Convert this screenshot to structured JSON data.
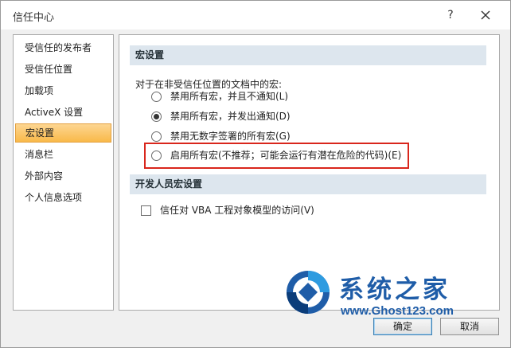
{
  "window": {
    "title": "信任中心",
    "help_label": "?"
  },
  "sidebar": {
    "items": [
      {
        "label": "受信任的发布者",
        "selected": false
      },
      {
        "label": "受信任位置",
        "selected": false
      },
      {
        "label": "加载项",
        "selected": false
      },
      {
        "label": "ActiveX 设置",
        "selected": false
      },
      {
        "label": "宏设置",
        "selected": true
      },
      {
        "label": "消息栏",
        "selected": false
      },
      {
        "label": "外部内容",
        "selected": false
      },
      {
        "label": "个人信息选项",
        "selected": false
      }
    ]
  },
  "macro_settings": {
    "header": "宏设置",
    "prompt": "对于在非受信任位置的文档中的宏:",
    "options": [
      {
        "label": "禁用所有宏，并且不通知(L)",
        "checked": false
      },
      {
        "label": "禁用所有宏，并发出通知(D)",
        "checked": true
      },
      {
        "label": "禁用无数字签署的所有宏(G)",
        "checked": false
      },
      {
        "label": "启用所有宏(不推荐；可能会运行有潜在危险的代码)(E)",
        "checked": false
      }
    ]
  },
  "developer": {
    "header": "开发人员宏设置",
    "trust_vba_label": "信任对 VBA 工程对象模型的访问(V)",
    "trust_vba_checked": false
  },
  "watermark": {
    "title": "系统之家",
    "url": "www.Ghost123.com"
  },
  "buttons": {
    "ok": "确定",
    "cancel": "取消"
  },
  "colors": {
    "selected_item": "#f9b949",
    "section_header": "#dde6ee",
    "highlight_box": "#d9261c",
    "watermark": "#1f5da8"
  }
}
